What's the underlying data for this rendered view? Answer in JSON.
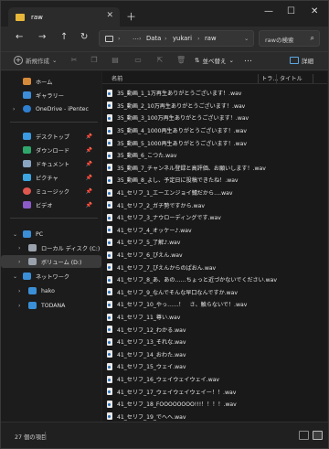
{
  "tab": {
    "title": "raw"
  },
  "nav": {
    "breadcrumbs": [
      "Data",
      "yukari",
      "raw"
    ],
    "more": "…",
    "search_placeholder": "rawの検索"
  },
  "toolbar": {
    "new_label": "新規作成",
    "sort_label": "並べ替え",
    "more": "…",
    "details_label": "詳細"
  },
  "columns": {
    "name": "名前",
    "track": "トラ…",
    "title": "タイトル"
  },
  "sidebar": {
    "home": "ホーム",
    "gallery": "ギャラリー",
    "onedrive": "OneDrive - iPentec",
    "desktop": "デスクトップ",
    "downloads": "ダウンロード",
    "documents": "ドキュメント",
    "pictures": "ピクチャ",
    "music": "ミュージック",
    "videos": "ビデオ",
    "pc": "PC",
    "local_disk": "ローカル ディスク (C:)",
    "volume": "ボリューム (D:)",
    "network": "ネットワーク",
    "hako": "hako",
    "todana": "TODANA"
  },
  "files": [
    "35_動画_1_1万再生ありがとうございます！.wav",
    "35_動画_2_10万再生ありがとうございます！.wav",
    "35_動画_3_100万再生ありがとうございます！.wav",
    "35_動画_4_1000再生ありがとうございます！.wav",
    "35_動画_5_1000再生ありがとうございます！.wav",
    "35_動画_6_こつた.wav",
    "35_動画_7_チャンネル登録と高評価、お願いします！.wav",
    "35_動画_8_よし、予定日に投稿できたね！.wav",
    "41_セリフ_1_エーエンジョイ鯖だから….wav",
    "41_セリフ_2_ガチ勢ですから.wav",
    "41_セリフ_3_ナウローディングです.wav",
    "41_セリフ_4_オッケー♪.wav",
    "41_セリフ_5_了解♪.wav",
    "41_セリフ_6_ぴえん.wav",
    "41_セリフ_7_ぴえんからのぱおん.wav",
    "41_セリフ_8_あ、あの……ちょっと近づかないでください.wav",
    "41_セリフ_9_なんでそんな早口なんですか.wav",
    "41_セリフ_10_やっ……！　さ、触らないで！.wav",
    "41_セリフ_11_尊い.wav",
    "41_セリフ_12_わかる.wav",
    "41_セリフ_13_それな.wav",
    "41_セリフ_14_おわた.wav",
    "41_セリフ_15_ウェイ.wav",
    "41_セリフ_16_ウェイウェイウェイ.wav",
    "41_セリフ_17_ウェイウェイウェイー！！.wav",
    "41_セリフ_18_FOOOOOOOO!!!！！！！.wav",
    "41_セリフ_19_でへへ.wav"
  ],
  "status": {
    "count": "27 個の項目"
  }
}
